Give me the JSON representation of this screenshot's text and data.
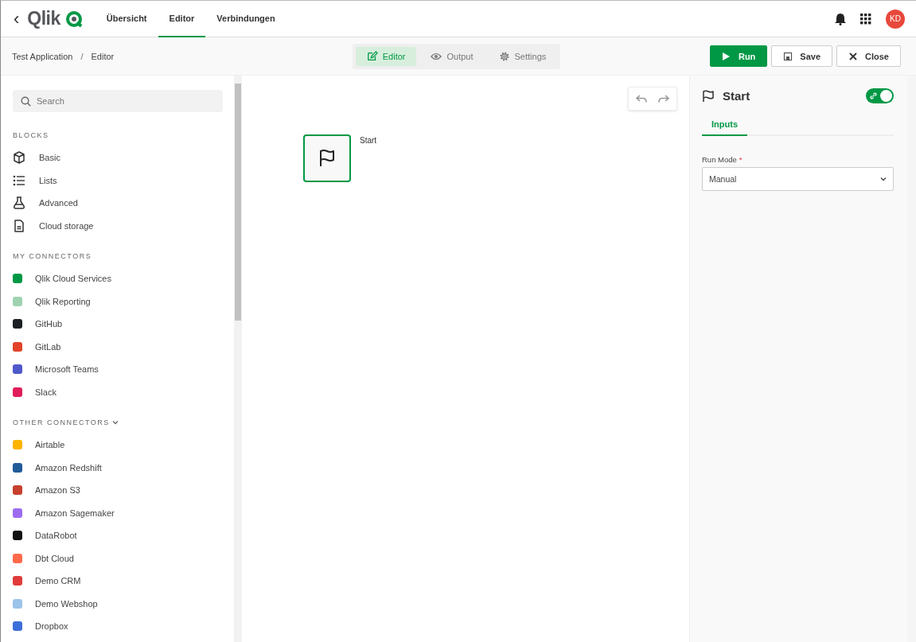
{
  "header": {
    "back": "‹",
    "logo": "Qlik",
    "nav": [
      {
        "label": "Übersicht",
        "selected": false
      },
      {
        "label": "Editor",
        "selected": true
      },
      {
        "label": "Verbindungen",
        "selected": false
      }
    ],
    "avatar": "KD"
  },
  "toolbar": {
    "breadcrumb": [
      "Test Application",
      "Editor"
    ],
    "separator": "/",
    "modes": [
      {
        "label": "Editor",
        "kind": "edit",
        "selected": true
      },
      {
        "label": "Output",
        "kind": "eye",
        "selected": false
      },
      {
        "label": "Settings",
        "kind": "gear",
        "selected": false
      }
    ],
    "actions": [
      {
        "label": "Run",
        "kind": "run"
      },
      {
        "label": "Save",
        "kind": "save"
      },
      {
        "label": "Close",
        "kind": "close"
      }
    ]
  },
  "sidebar": {
    "search": {
      "placeholder": "Search"
    },
    "blocks": {
      "title": "BLOCKS",
      "items": [
        {
          "label": "Basic",
          "kind": "cube"
        },
        {
          "label": "Lists",
          "kind": "list"
        },
        {
          "label": "Advanced",
          "kind": "flask"
        },
        {
          "label": "Cloud storage",
          "kind": "document"
        }
      ]
    },
    "my_connectors": {
      "title": "MY CONNECTORS",
      "items": [
        {
          "label": "Qlik Cloud Services",
          "color": "#009845"
        },
        {
          "label": "Qlik Reporting",
          "color": "#9fd3b0"
        },
        {
          "label": "GitHub",
          "color": "#1b1f23"
        },
        {
          "label": "GitLab",
          "color": "#e24329"
        },
        {
          "label": "Microsoft Teams",
          "color": "#5059c9"
        },
        {
          "label": "Slack",
          "color": "#e01e5a"
        }
      ]
    },
    "other_connectors": {
      "title": "OTHER CONNECTORS",
      "expanded": true,
      "items": [
        {
          "label": "Airtable",
          "color": "#fcb400"
        },
        {
          "label": "Amazon Redshift",
          "color": "#205b98"
        },
        {
          "label": "Amazon S3",
          "color": "#c7402d"
        },
        {
          "label": "Amazon Sagemaker",
          "color": "#9d6bf0"
        },
        {
          "label": "DataRobot",
          "color": "#111111"
        },
        {
          "label": "Dbt Cloud",
          "color": "#ff694b"
        },
        {
          "label": "Demo CRM",
          "color": "#e23b3b"
        },
        {
          "label": "Demo Webshop",
          "color": "#9cc3ea"
        },
        {
          "label": "Dropbox",
          "color": "#3d6fd9"
        }
      ]
    }
  },
  "canvas": {
    "node": {
      "label": "Start",
      "selected": true
    }
  },
  "properties": {
    "title": "Start",
    "toggle_on": true,
    "tabs": [
      {
        "label": "Inputs",
        "selected": true
      }
    ],
    "fields": [
      {
        "label": "Run Mode",
        "required_mark": "*",
        "value": "Manual"
      }
    ]
  }
}
